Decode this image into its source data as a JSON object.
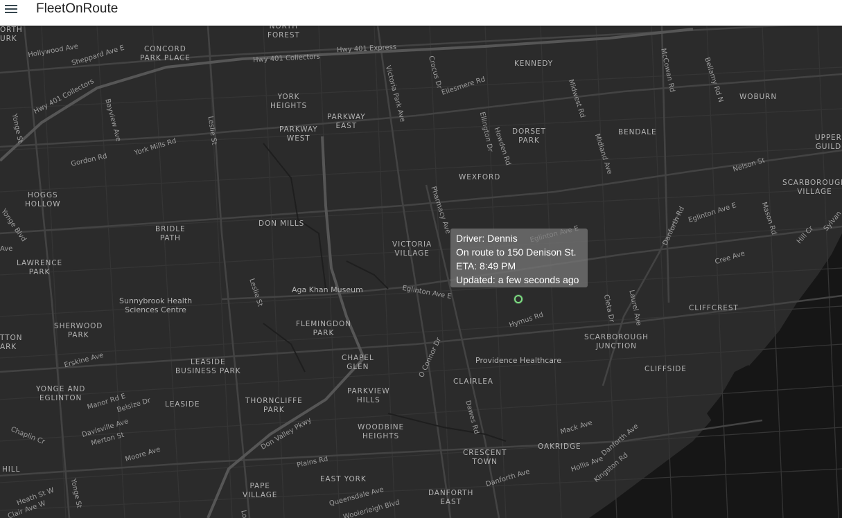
{
  "app": {
    "title": "FleetOnRoute",
    "menu_icon": "hamburger-menu-icon"
  },
  "map": {
    "theme_colors": {
      "background": "#2b2b2b",
      "road": "#3d3d3d",
      "highway": "#4a4a4a",
      "water": "#161616",
      "marker": "#7ddc82"
    },
    "areas": [
      "ORTH\nURK",
      "NORTH\nFOREST",
      "CONCORD\nPARK PLACE",
      "YORK\nHEIGHTS",
      "PARKWAY\nEAST",
      "PARKWAY\nWEST",
      "KENNEDY",
      "DORSET\nPARK",
      "WOBURN",
      "BENDALE",
      "UPPER\nGUILD",
      "WEXFORD",
      "HOGGS\nHOLLOW",
      "BRIDLE\nPATH",
      "DON MILLS",
      "VICTORIA\nVILLAGE",
      "SCARBOROUGH\nVILLAGE",
      "LAWRENCE\nPARK",
      "FLEMINGDON\nPARK",
      "CLIFFCREST",
      "SHERWOOD\nPARK",
      "SCARBOROUGH\nJUNCTION",
      "LEASIDE\nBUSINESS PARK",
      "CHAPEL\nGLEN",
      "CLIFFSIDE",
      "YONGE AND\nEGLINTON",
      "CLAIRLEA",
      "LEASIDE",
      "THORNCLIFFE\nPARK",
      "PARKVIEW\nHILLS",
      "WOODBINE\nHEIGHTS",
      "CRESCENT\nTOWN",
      "OAKRIDGE",
      "EAST YORK",
      "PAPE\nVILLAGE",
      "DANFORTH\nEAST",
      "HILL",
      "TTON\nARK"
    ],
    "roads": [
      "Hollywood Ave",
      "Sheppard Ave E",
      "Hwy 401 Express",
      "Hwy 401 Collectors",
      "Hwy 401 Collectors",
      "Yonge St",
      "Bayview Ave",
      "Gordon Rd",
      "York Mills Rd",
      "Leslie St",
      "Victoria Park Ave",
      "Crocus Dr",
      "Ellesmere Rd",
      "Ellington Dr",
      "Howden Rd",
      "Midwest Rd",
      "McCowan Rd",
      "Bellamy Rd N",
      "Midland Ave",
      "Nelson St",
      "Pharmacy Ave",
      "Eglinton Ave E",
      "Eglinton Ave E",
      "Danforth Rd",
      "Mason Rd",
      "Hill Cr",
      "Sylvan",
      "Cree Ave",
      "Leslie St",
      "Eglinton Ave E",
      "Hymus Rd",
      "Cleta Dr",
      "Laurel Ave",
      "Yonge Blvd",
      "Ave",
      "O Connor Dr",
      "Erskine Ave",
      "Manor Rd E",
      "Belsize Dr",
      "Davisville Ave",
      "Merton St",
      "Chaplin Cr",
      "Moore Ave",
      "Don Valley Pkwy",
      "Dawes Rd",
      "Mack Ave",
      "Danforth Ave",
      "Hollis Ave",
      "Kingston Rd",
      "Danforth Ave",
      "Plains Rd",
      "Heath St W",
      "Clair Ave W",
      "Yonge St",
      "Queensdale Ave",
      "Woolerleigh Blvd",
      "Lo"
    ],
    "pois": [
      "Sunnybrook Health\nSciences Centre",
      "Aga Khan Museum",
      "Providence Healthcare"
    ]
  },
  "tooltip": {
    "driver": "Driver: Dennis",
    "route": "On route to 150 Denison St.",
    "eta": "ETA: 8:49 PM",
    "updated": "Updated: a few seconds ago"
  },
  "marker_icon": "vehicle-location-marker-icon"
}
